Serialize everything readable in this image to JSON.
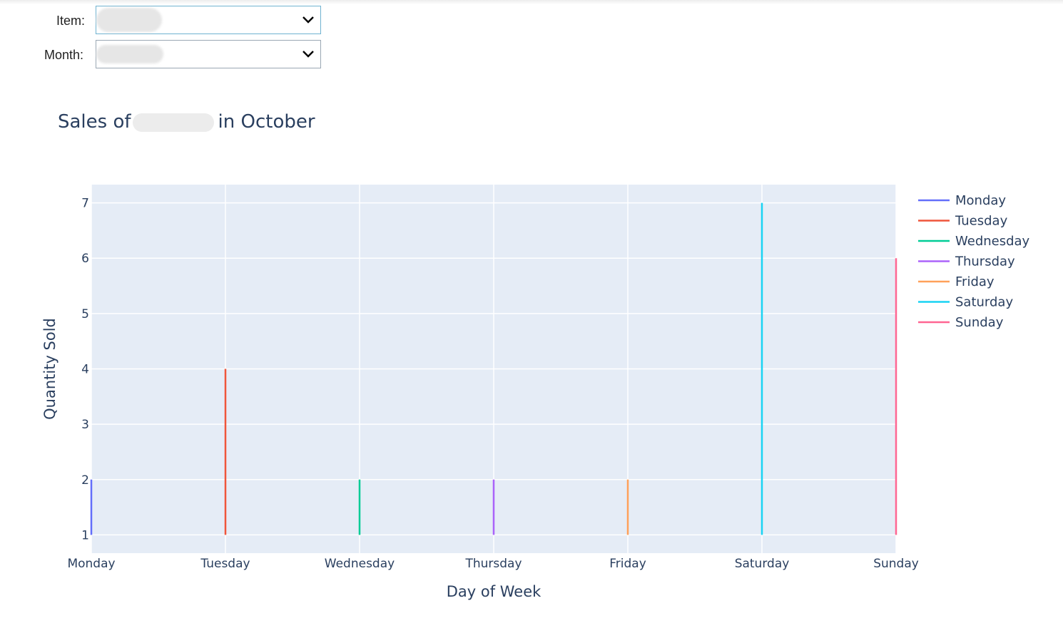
{
  "controls": {
    "item_label": "Item:",
    "month_label": "Month:"
  },
  "title": {
    "prefix": "Sales of",
    "suffix": "in October"
  },
  "colors": {
    "plot_bg": "#e5ecf6",
    "grid": "#ffffff",
    "text": "#2a3f5f"
  },
  "chart_data": {
    "type": "line",
    "title": "Sales of [redacted] in October",
    "xlabel": "Day of Week",
    "ylabel": "Quantity Sold",
    "categories": [
      "Monday",
      "Tuesday",
      "Wednesday",
      "Thursday",
      "Friday",
      "Saturday",
      "Sunday"
    ],
    "ylim": [
      0.67,
      7.33
    ],
    "yticks": [
      1,
      2,
      3,
      4,
      5,
      6,
      7
    ],
    "grid": true,
    "legend": "top-right",
    "series": [
      {
        "name": "Monday",
        "color": "#636efa",
        "x": "Monday",
        "values": [
          1,
          2
        ]
      },
      {
        "name": "Tuesday",
        "color": "#ef553b",
        "x": "Tuesday",
        "values": [
          1,
          4
        ]
      },
      {
        "name": "Wednesday",
        "color": "#00cc96",
        "x": "Wednesday",
        "values": [
          1,
          2
        ]
      },
      {
        "name": "Thursday",
        "color": "#ab63fa",
        "x": "Thursday",
        "values": [
          1,
          2
        ]
      },
      {
        "name": "Friday",
        "color": "#ffa15a",
        "x": "Friday",
        "values": [
          1,
          2
        ]
      },
      {
        "name": "Saturday",
        "color": "#19d3f3",
        "x": "Saturday",
        "values": [
          1,
          7
        ]
      },
      {
        "name": "Sunday",
        "color": "#ff6692",
        "x": "Sunday",
        "values": [
          1,
          6
        ]
      }
    ]
  }
}
